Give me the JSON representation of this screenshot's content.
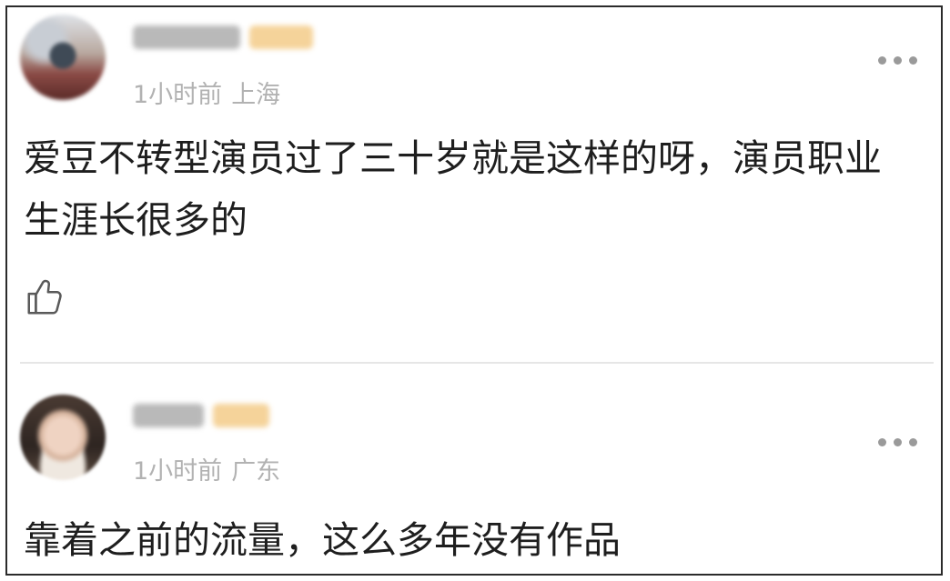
{
  "comments": [
    {
      "time": "1小时前",
      "location": "上海",
      "text": "爱豆不转型演员过了三十岁就是这样的呀，演员职业生涯长很多的",
      "avatar_icon": "avatar-blurred",
      "like_icon": "thumbs-up-outline-icon"
    },
    {
      "time": "1小时前",
      "location": "广东",
      "text": "靠着之前的流量，这么多年没有作品",
      "avatar_icon": "avatar-blurred"
    }
  ],
  "colors": {
    "text": "#1e1e1e",
    "meta": "#b2b2b2",
    "divider": "#e6e6e6",
    "badge_blur": "#f5d39a",
    "name_blur": "#b9b9b9"
  }
}
